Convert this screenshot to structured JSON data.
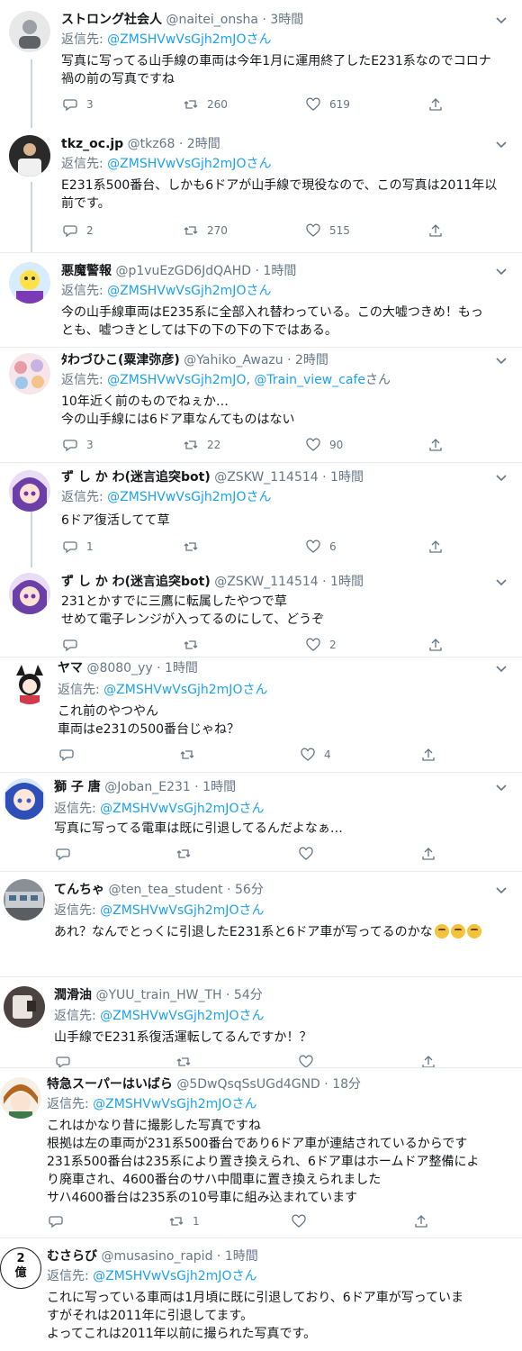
{
  "tweets": [
    {
      "name": "ストロング社会人",
      "handle": "@naitei_onsha",
      "dot": "·",
      "time": "3時間",
      "reply_label": "返信先:",
      "mentions": "@ZMSHVwVsGjh2mJOさん",
      "lines": [
        "写真に写ってる山手線の車両は今年1月に運用終了したE231系なのでコロナ",
        "禍の前の写真ですね"
      ],
      "replies": "3",
      "retweets": "260",
      "likes": "619"
    },
    {
      "name": "tkz_oc.jp",
      "handle": "@tkz68",
      "dot": "·",
      "time": "2時間",
      "reply_label": "返信先:",
      "mentions": "@ZMSHVwVsGjh2mJOさん",
      "lines": [
        "E231系500番台、しかも6ドアが山手線で現役なので、この写真は2011年以",
        "前です。"
      ],
      "replies": "2",
      "retweets": "270",
      "likes": "515"
    },
    {
      "name": "悪魔警報",
      "handle": "@p1vuEzGD6JdQAHD",
      "dot": "·",
      "time": "1時間",
      "reply_label": "返信先:",
      "mentions": "@ZMSHVwVsGjh2mJOさん",
      "lines": [
        "今の山手線車両はE235系に全部入れ替わっている。この大嘘つきめ！もっ",
        "とも、嘘つきとしては下の下の下の下ではある。"
      ]
    },
    {
      "name": "ﾀわづひこ(粟津弥彦)",
      "handle": "@Yahiko_Awazu",
      "dot": "·",
      "time": "2時間",
      "reply_label": "返信先:",
      "mentions": "@ZMSHVwVsGjh2mJO",
      "mentions_sep": ", ",
      "mentions2": "@Train_view_cafe",
      "mentions_suffix": "さん",
      "lines": [
        "10年近く前のものでねぇか…",
        "今の山手線には6ドア車なんてものはない"
      ],
      "replies": "3",
      "retweets": "22",
      "likes": "90"
    },
    {
      "name": "ず し か わ(迷言追突bot)",
      "handle": "@ZSKW_114514",
      "dot": "·",
      "time": "1時間",
      "reply_label": "返信先:",
      "mentions": "@ZMSHVwVsGjh2mJOさん",
      "lines": [
        "6ドア復活してて草"
      ],
      "replies": "1",
      "retweets": "",
      "likes": "6"
    },
    {
      "name": "ず し か わ(迷言追突bot)",
      "handle": "@ZSKW_114514",
      "dot": "·",
      "time": "1時間",
      "lines": [
        "231とかすでに三鷹に転属したやつで草",
        "せめて電子レンジが入ってるのにして、どうぞ"
      ],
      "replies": "",
      "retweets": "",
      "likes": "2"
    },
    {
      "name": "ヤマ",
      "handle": "@8080_yy",
      "dot": "·",
      "time": "1時間",
      "reply_label": "返信先:",
      "mentions": "@ZMSHVwVsGjh2mJOさん",
      "lines": [
        "これ前のやつやん",
        "車両はe231の500番台じゃね？"
      ],
      "replies": "",
      "retweets": "",
      "likes": "4"
    },
    {
      "name": "獅 子 唐",
      "handle": "@Joban_E231",
      "dot": "·",
      "time": "1時間",
      "reply_label": "返信先:",
      "mentions": "@ZMSHVwVsGjh2mJOさん",
      "lines": [
        "写真に写ってる電車は既に引退してるんだよなぁ…"
      ]
    },
    {
      "name": "てんちゃ",
      "handle": "@ten_tea_student",
      "dot": "·",
      "time": "56分",
      "reply_label": "返信先:",
      "mentions": "@ZMSHVwVsGjh2mJOさん",
      "lines": [
        "あれ？なんでとっくに引退したE231系と6ドア車が写ってるのかな"
      ]
    },
    {
      "name": "潤滑油",
      "handle": "@YUU_train_HW_TH",
      "dot": "·",
      "time": "54分",
      "reply_label": "返信先:",
      "mentions": "@ZMSHVwVsGjh2mJOさん",
      "lines": [
        "山手線でE231系復活運転してるんですか！？"
      ]
    },
    {
      "name": "特急スーパーはいばら",
      "handle": "@5DwQsqSsUGd4GND",
      "dot": "·",
      "time": "18分",
      "reply_label": "返信先:",
      "mentions": "@ZMSHVwVsGjh2mJOさん",
      "lines": [
        "これはかなり昔に撮影した写真ですね",
        "根拠は左の車両が231系500番台であり6ドア車が連結されているからです",
        "231系500番台は235系により置き換えられ、6ドア車はホームドア整備によ",
        "り廃車され、4600番台のサハ中間車に置き換えられました",
        "サハ4600番台は235系の10号車に組み込まれています"
      ],
      "replies": "",
      "retweets": "1",
      "likes": ""
    },
    {
      "name": "むさらび",
      "handle": "@musasino_rapid",
      "dot": "·",
      "time": "1時間",
      "reply_label": "返信先:",
      "mentions": "@ZMSHVwVsGjh2mJOさん",
      "lines": [
        "これに写っている車両は1月頃に既に引退しており、6ドア車が写っていま",
        "すがそれは2011年に引退してます。",
        "よってこれは2011年以前に撮られた写真です。"
      ]
    }
  ],
  "avatar_badge": [
    "2",
    "億"
  ],
  "colors": {
    "link": "#1da1f2",
    "meta": "#657786",
    "text": "#14171a",
    "border": "#e6ecf0"
  }
}
